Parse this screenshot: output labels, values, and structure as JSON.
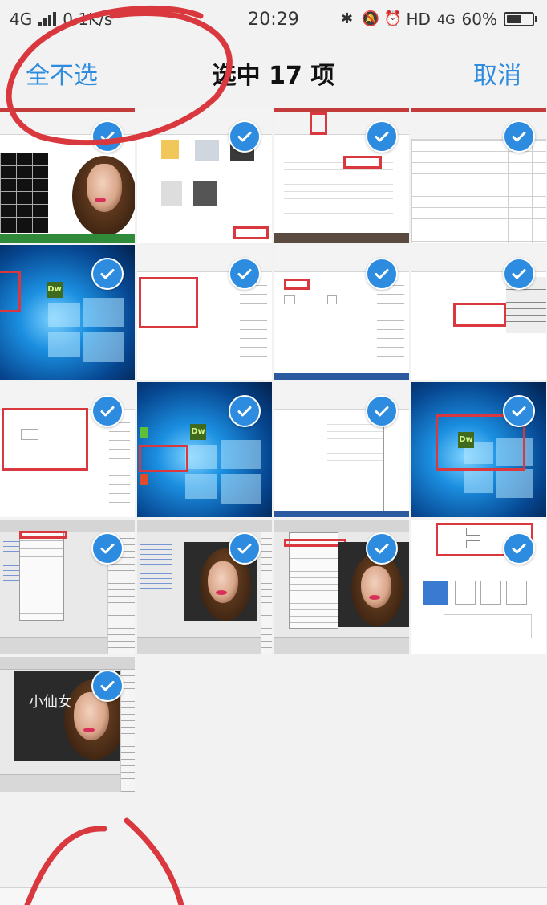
{
  "status_bar": {
    "network": "4G",
    "speed": "0.1K/s",
    "time": "20:29",
    "hd_label": "HD",
    "network_right": "4G",
    "battery": "60%",
    "battery_level": 0.6
  },
  "action_bar": {
    "select_none": "全不选",
    "title": "选中 17 项",
    "cancel": "取消"
  },
  "thumbnails": [
    {
      "kind": "photo-excel",
      "selected": true
    },
    {
      "kind": "explorer",
      "selected": true
    },
    {
      "kind": "doc-red",
      "selected": true
    },
    {
      "kind": "excel",
      "selected": true
    },
    {
      "kind": "desktop",
      "selected": true
    },
    {
      "kind": "doc",
      "selected": true
    },
    {
      "kind": "doc",
      "selected": true
    },
    {
      "kind": "doc",
      "selected": true
    },
    {
      "kind": "doc",
      "selected": true
    },
    {
      "kind": "desktop",
      "selected": true
    },
    {
      "kind": "doc",
      "selected": true
    },
    {
      "kind": "desktop-box",
      "selected": true
    },
    {
      "kind": "dreamweaver",
      "selected": true
    },
    {
      "kind": "dw-photo",
      "selected": true
    },
    {
      "kind": "dw-photo",
      "selected": true
    },
    {
      "kind": "dialog",
      "selected": true
    },
    {
      "kind": "photo-caption",
      "selected": true,
      "caption": "小仙女"
    }
  ],
  "colors": {
    "accent": "#2d8ce0",
    "annotation": "#d9393e"
  }
}
